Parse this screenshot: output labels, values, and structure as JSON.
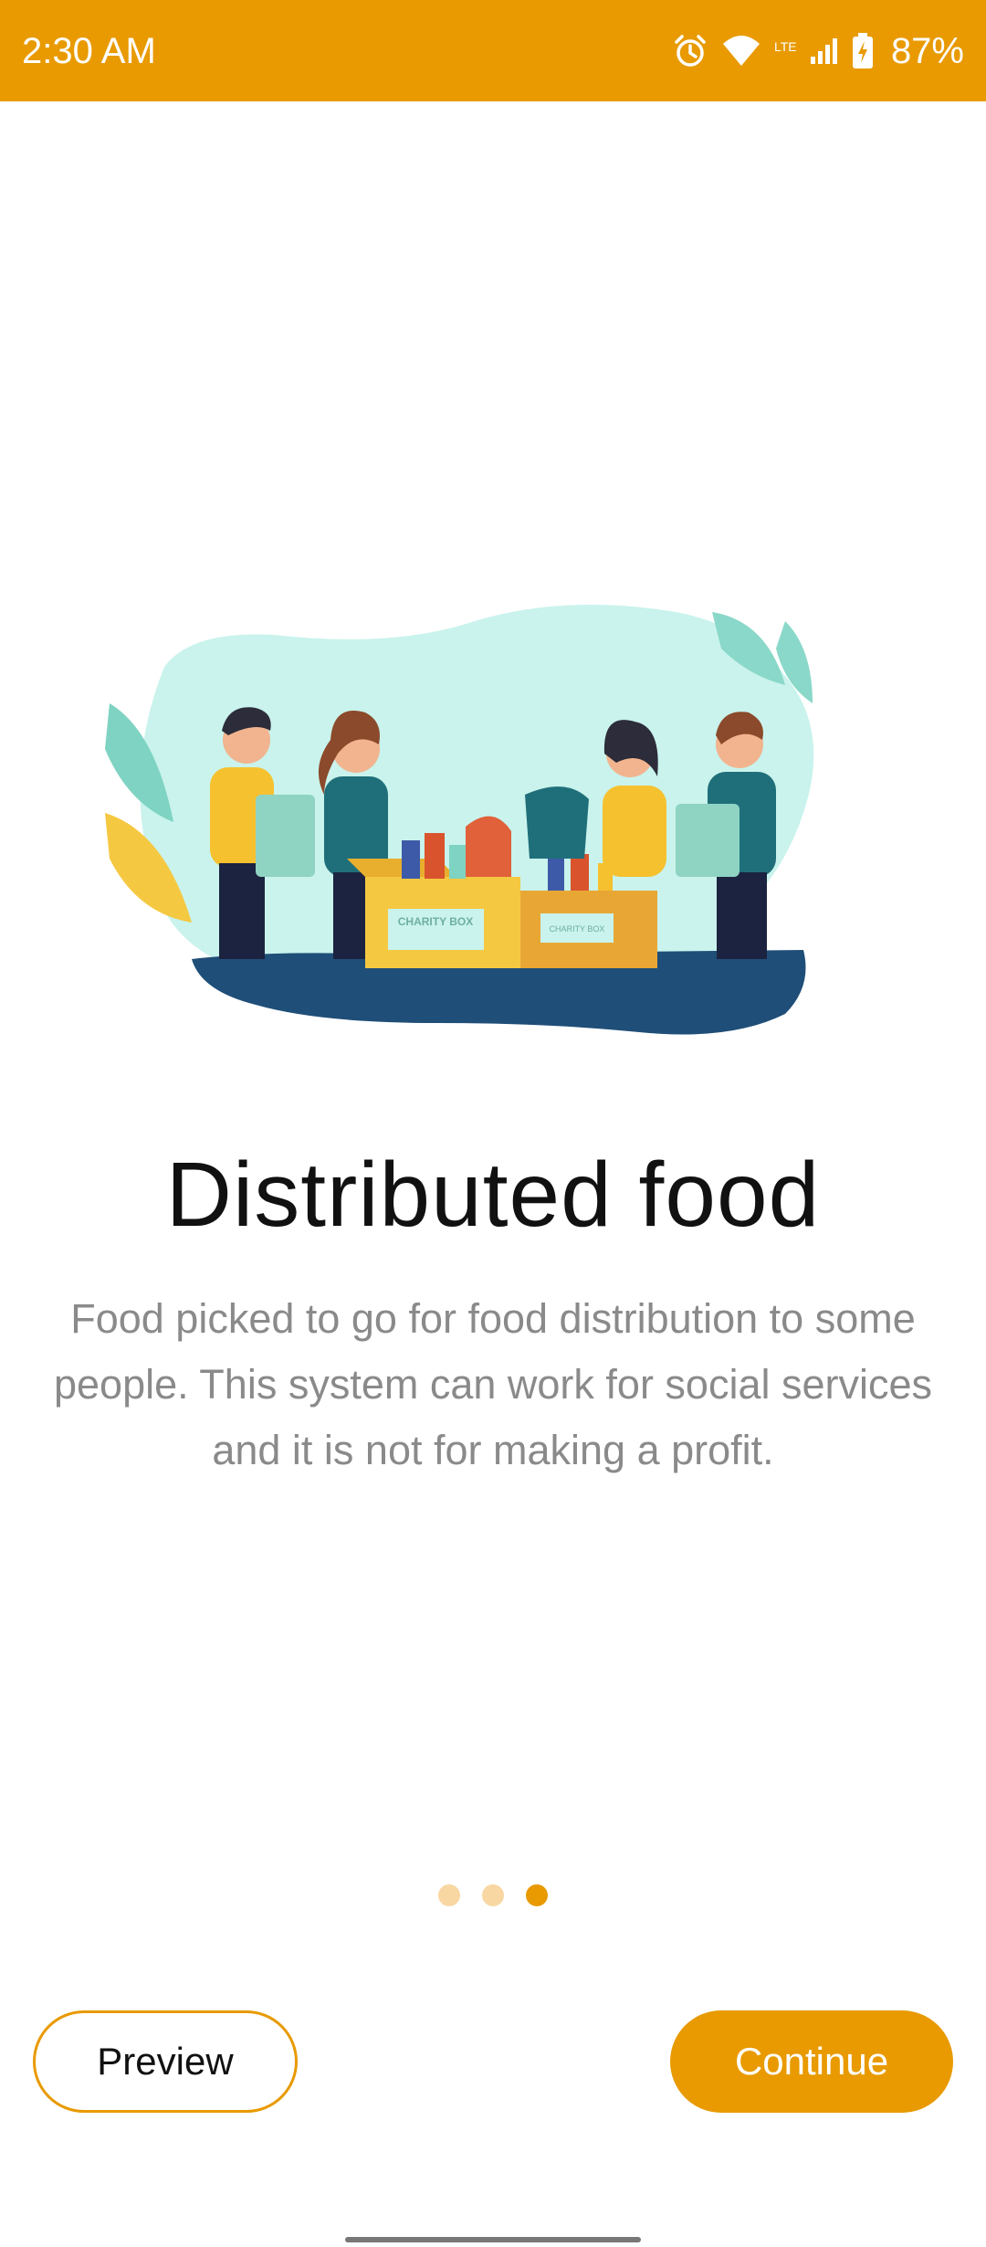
{
  "status_bar": {
    "time": "2:30 AM",
    "network": "LTE",
    "battery_percent": "87%",
    "icons": [
      "alarm-icon",
      "wifi-icon",
      "lte-signal-icon",
      "battery-charging-icon"
    ]
  },
  "onboarding": {
    "illustration": "charity-volunteers-illustration",
    "box_label_1": "CHARITY BOX",
    "box_label_2": "CHARITY BOX",
    "title": "Distributed food",
    "description": "Food picked to go for food distribution to some people. This system can work for social services and it is not for making a profit.",
    "page_count": 3,
    "current_page": 3
  },
  "buttons": {
    "preview_label": "Preview",
    "continue_label": "Continue"
  },
  "colors": {
    "accent": "#E89A00",
    "dot_inactive": "#F8D7A3",
    "description_text": "#8a8a8a"
  }
}
